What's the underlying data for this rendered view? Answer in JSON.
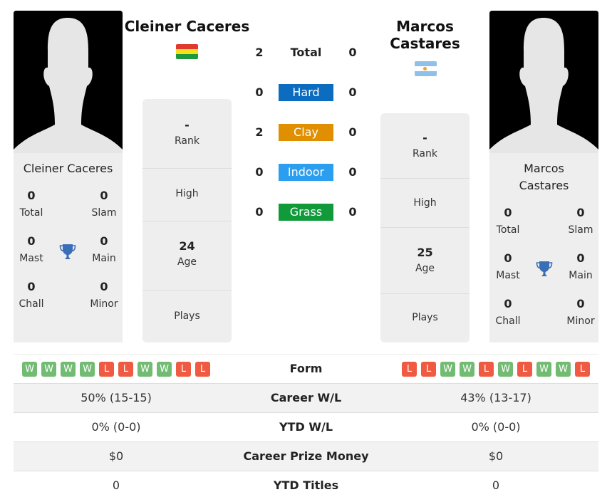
{
  "players": {
    "left": {
      "name": "Cleiner Caceres",
      "flag": "bolivia-flag",
      "card_name": "Cleiner Caceres",
      "titles": {
        "total": {
          "value": "0",
          "label": "Total"
        },
        "slam": {
          "value": "0",
          "label": "Slam"
        },
        "mast": {
          "value": "0",
          "label": "Mast"
        },
        "main": {
          "value": "0",
          "label": "Main"
        },
        "chall": {
          "value": "0",
          "label": "Chall"
        },
        "minor": {
          "value": "0",
          "label": "Minor"
        }
      },
      "info": {
        "rank": {
          "value": "-",
          "label": "Rank"
        },
        "high": {
          "value": "",
          "label": "High"
        },
        "age": {
          "value": "24",
          "label": "Age"
        },
        "plays": {
          "value": "",
          "label": "Plays"
        }
      }
    },
    "right": {
      "name_line1": "Marcos",
      "name_line2": "Castares",
      "flag": "argentina-flag",
      "card_name_line1": "Marcos",
      "card_name_line2": "Castares",
      "titles": {
        "total": {
          "value": "0",
          "label": "Total"
        },
        "slam": {
          "value": "0",
          "label": "Slam"
        },
        "mast": {
          "value": "0",
          "label": "Mast"
        },
        "main": {
          "value": "0",
          "label": "Main"
        },
        "chall": {
          "value": "0",
          "label": "Chall"
        },
        "minor": {
          "value": "0",
          "label": "Minor"
        }
      },
      "info": {
        "rank": {
          "value": "-",
          "label": "Rank"
        },
        "high": {
          "value": "",
          "label": "High"
        },
        "age": {
          "value": "25",
          "label": "Age"
        },
        "plays": {
          "value": "",
          "label": "Plays"
        }
      }
    }
  },
  "surfaces": [
    {
      "label": "Total",
      "left": "2",
      "right": "0",
      "color": null
    },
    {
      "label": "Hard",
      "left": "0",
      "right": "0",
      "color": "#0b6cc0"
    },
    {
      "label": "Clay",
      "left": "2",
      "right": "0",
      "color": "#e08f00"
    },
    {
      "label": "Indoor",
      "left": "0",
      "right": "0",
      "color": "#2b9ef0"
    },
    {
      "label": "Grass",
      "left": "0",
      "right": "0",
      "color": "#109a3a"
    }
  ],
  "comparison": {
    "form": {
      "label": "Form",
      "left": [
        "W",
        "W",
        "W",
        "W",
        "L",
        "L",
        "W",
        "W",
        "L",
        "L"
      ],
      "right": [
        "L",
        "L",
        "W",
        "W",
        "L",
        "W",
        "L",
        "W",
        "W",
        "L"
      ]
    },
    "rows": [
      {
        "label": "Career W/L",
        "left": "50% (15-15)",
        "right": "43% (13-17)"
      },
      {
        "label": "YTD W/L",
        "left": "0% (0-0)",
        "right": "0% (0-0)"
      },
      {
        "label": "Career Prize Money",
        "left": "$0",
        "right": "$0"
      },
      {
        "label": "YTD Titles",
        "left": "0",
        "right": "0"
      }
    ]
  },
  "colors": {
    "win": "#72bb72",
    "loss": "#ee5b42",
    "trophy": "#3a6fb8",
    "card_bg": "#eeeeee"
  }
}
